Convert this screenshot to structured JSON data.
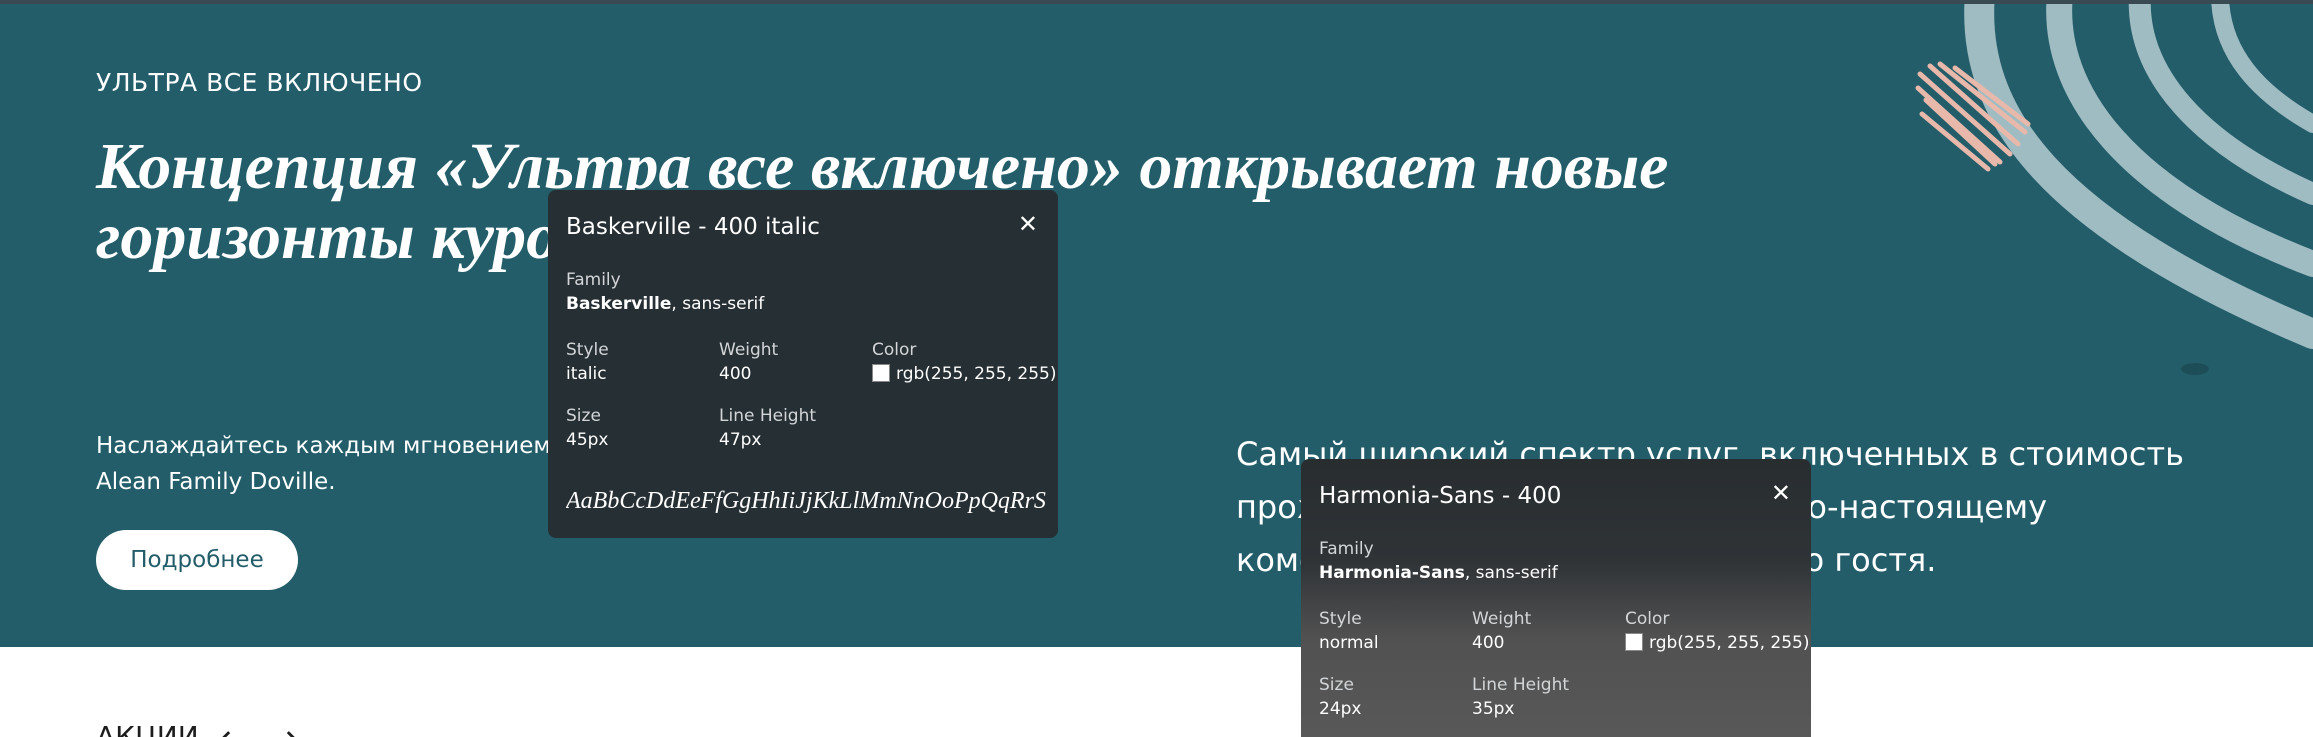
{
  "hero": {
    "eyebrow": "УЛЬТРА ВСЕ ВКЛЮЧЕНО",
    "headline": "Концепция «Ультра все включено» открывает новые горизонты курортного отдыха",
    "lead": "Наслаждайтесь каждым мгновением отдыха в отеле Alean Family Doville.",
    "cta_label": "Подробнее",
    "right_text": "Самый широкий спектр услуг, включенных в стоимость проживания, для беззаботного, по-настоящему комфортного отдыха для каждого гостя.",
    "background_color": "#235d69"
  },
  "next_section": {
    "label": "АКЦИИ",
    "prev_arrow": "←",
    "next_arrow": "→"
  },
  "font_popups": [
    {
      "title": "Baskerville - 400 italic",
      "close_icon": "close-icon",
      "family_label": "Family",
      "family_name": "Baskerville",
      "family_fallback": ", sans-serif",
      "style_label": "Style",
      "style_value": "italic",
      "weight_label": "Weight",
      "weight_value": "400",
      "color_label": "Color",
      "color_value": "rgb(255, 255, 255)",
      "size_label": "Size",
      "size_value": "45px",
      "line_height_label": "Line Height",
      "line_height_value": "47px",
      "sample": "AaBbCcDdEeFfGgHhIiJjKkLlMmNnOoPpQqRrSsTtU"
    },
    {
      "title": "Harmonia-Sans - 400",
      "close_icon": "close-icon",
      "family_label": "Family",
      "family_name": "Harmonia-Sans",
      "family_fallback": ", sans-serif",
      "style_label": "Style",
      "style_value": "normal",
      "weight_label": "Weight",
      "weight_value": "400",
      "color_label": "Color",
      "color_value": "rgb(255, 255, 255)",
      "size_label": "Size",
      "size_value": "24px",
      "line_height_label": "Line Height",
      "line_height_value": "35px"
    }
  ]
}
